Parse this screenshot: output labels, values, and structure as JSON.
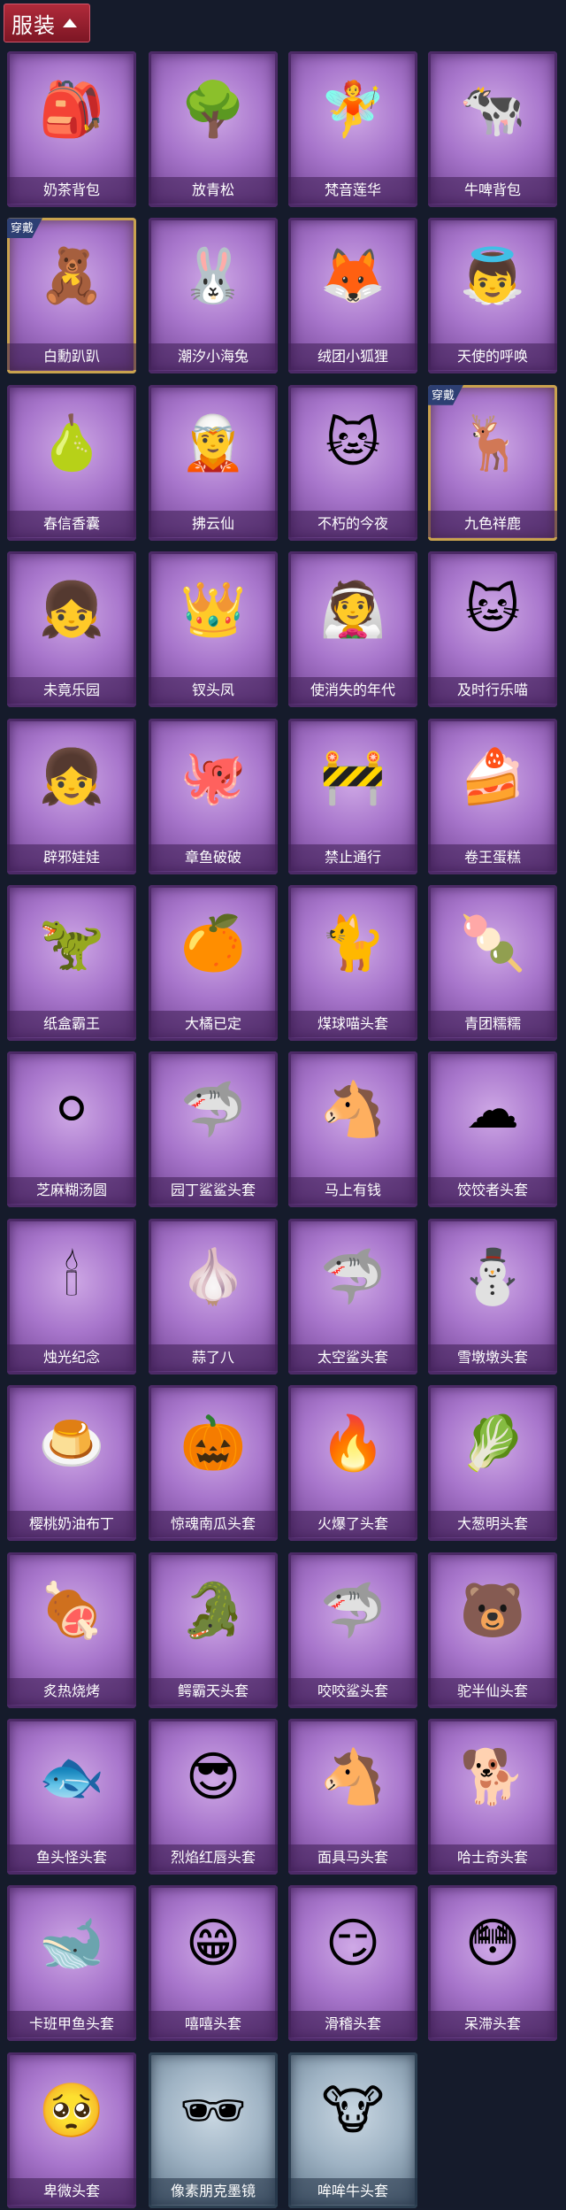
{
  "header": {
    "title": "服装"
  },
  "items": [
    {
      "name": "奶茶背包",
      "theme": "purple",
      "worn": false,
      "icon": "bag-icon"
    },
    {
      "name": "放青松",
      "theme": "purple",
      "worn": false,
      "icon": "bonsai-icon"
    },
    {
      "name": "梵音莲华",
      "theme": "purple",
      "worn": false,
      "icon": "doll-icon"
    },
    {
      "name": "牛啤背包",
      "theme": "purple",
      "worn": false,
      "icon": "barrel-icon"
    },
    {
      "name": "白勳趴趴",
      "theme": "purple",
      "worn": true,
      "badge": "穿戴",
      "icon": "bear-plush-icon"
    },
    {
      "name": "潮汐小海兔",
      "theme": "purple",
      "worn": false,
      "icon": "blue-rabbit-icon"
    },
    {
      "name": "绒团小狐狸",
      "theme": "purple",
      "worn": false,
      "icon": "fox-icon"
    },
    {
      "name": "天使的呼唤",
      "theme": "purple",
      "worn": false,
      "icon": "angel-icon"
    },
    {
      "name": "春信香囊",
      "theme": "purple",
      "worn": false,
      "icon": "sachet-icon"
    },
    {
      "name": "拂云仙",
      "theme": "purple",
      "worn": false,
      "icon": "fairy-icon"
    },
    {
      "name": "不朽的今夜",
      "theme": "purple",
      "worn": false,
      "icon": "pink-cat-icon"
    },
    {
      "name": "九色祥鹿",
      "theme": "purple",
      "worn": true,
      "badge": "穿戴",
      "icon": "deer-icon"
    },
    {
      "name": "未竟乐园",
      "theme": "purple",
      "worn": false,
      "icon": "girl-doll-icon"
    },
    {
      "name": "钗头凤",
      "theme": "purple",
      "worn": false,
      "icon": "crown-icon"
    },
    {
      "name": "使消失的年代",
      "theme": "purple",
      "worn": false,
      "icon": "veil-doll-icon"
    },
    {
      "name": "及时行乐喵",
      "theme": "purple",
      "worn": false,
      "icon": "cat-face-icon"
    },
    {
      "name": "辟邪娃娃",
      "theme": "purple",
      "worn": false,
      "icon": "girl-icon"
    },
    {
      "name": "章鱼破破",
      "theme": "purple",
      "worn": false,
      "icon": "octopus-icon"
    },
    {
      "name": "禁止通行",
      "theme": "purple",
      "worn": false,
      "icon": "barrier-icon"
    },
    {
      "name": "卷王蛋糕",
      "theme": "purple",
      "worn": false,
      "icon": "cake-icon"
    },
    {
      "name": "纸盒霸王",
      "theme": "purple",
      "worn": false,
      "icon": "dino-box-icon"
    },
    {
      "name": "大橘已定",
      "theme": "purple",
      "worn": false,
      "icon": "orange-icon"
    },
    {
      "name": "煤球喵头套",
      "theme": "purple",
      "worn": false,
      "icon": "black-cat-icon"
    },
    {
      "name": "青团糯糯",
      "theme": "purple",
      "worn": false,
      "icon": "green-ball-icon"
    },
    {
      "name": "芝麻糊汤圆",
      "theme": "purple",
      "worn": false,
      "icon": "dumpling-icon"
    },
    {
      "name": "园丁鲨鲨头套",
      "theme": "purple",
      "worn": false,
      "icon": "shark-bee-icon"
    },
    {
      "name": "马上有钱",
      "theme": "purple",
      "worn": false,
      "icon": "horse-icon"
    },
    {
      "name": "饺饺者头套",
      "theme": "purple",
      "worn": false,
      "icon": "cloud-dumpling-icon"
    },
    {
      "name": "烛光纪念",
      "theme": "purple",
      "worn": false,
      "icon": "candle-icon"
    },
    {
      "name": "蒜了八",
      "theme": "purple",
      "worn": false,
      "icon": "garlic-icon"
    },
    {
      "name": "太空鲨头套",
      "theme": "purple",
      "worn": false,
      "icon": "space-shark-icon"
    },
    {
      "name": "雪墩墩头套",
      "theme": "purple",
      "worn": false,
      "icon": "snowman-icon"
    },
    {
      "name": "樱桃奶油布丁",
      "theme": "purple",
      "worn": false,
      "icon": "pudding-icon"
    },
    {
      "name": "惊魂南瓜头套",
      "theme": "purple",
      "worn": false,
      "icon": "pumpkin-icon"
    },
    {
      "name": "火爆了头套",
      "theme": "purple",
      "worn": false,
      "icon": "fire-icon"
    },
    {
      "name": "大葱明头套",
      "theme": "purple",
      "worn": false,
      "icon": "scallion-icon"
    },
    {
      "name": "炙热烧烤",
      "theme": "purple",
      "worn": false,
      "icon": "bbq-icon"
    },
    {
      "name": "鳄霸天头套",
      "theme": "purple",
      "worn": false,
      "icon": "crocodile-icon"
    },
    {
      "name": "咬咬鲨头套",
      "theme": "purple",
      "worn": false,
      "icon": "shark-icon"
    },
    {
      "name": "驼半仙头套",
      "theme": "purple",
      "worn": false,
      "icon": "bear-glasses-icon"
    },
    {
      "name": "鱼头怪头套",
      "theme": "purple",
      "worn": false,
      "icon": "fish-head-icon"
    },
    {
      "name": "烈焰红唇头套",
      "theme": "purple",
      "worn": false,
      "icon": "yellow-mask-icon"
    },
    {
      "name": "面具马头套",
      "theme": "purple",
      "worn": false,
      "icon": "horse-mask-icon"
    },
    {
      "name": "哈士奇头套",
      "theme": "purple",
      "worn": false,
      "icon": "husky-icon"
    },
    {
      "name": "卡班甲鱼头套",
      "theme": "purple",
      "worn": false,
      "icon": "whale-icon"
    },
    {
      "name": "嘻嘻头套",
      "theme": "purple",
      "worn": false,
      "icon": "grin-emoji-icon"
    },
    {
      "name": "滑稽头套",
      "theme": "purple",
      "worn": false,
      "icon": "smirk-emoji-icon"
    },
    {
      "name": "呆滞头套",
      "theme": "purple",
      "worn": false,
      "icon": "flushed-emoji-icon"
    },
    {
      "name": "卑微头套",
      "theme": "purple",
      "worn": false,
      "icon": "pleading-emoji-icon"
    },
    {
      "name": "像素朋克墨镜",
      "theme": "blue",
      "worn": false,
      "icon": "pixel-sunglasses-icon"
    },
    {
      "name": "哞哞牛头套",
      "theme": "blue",
      "worn": false,
      "icon": "cow-icon"
    }
  ]
}
